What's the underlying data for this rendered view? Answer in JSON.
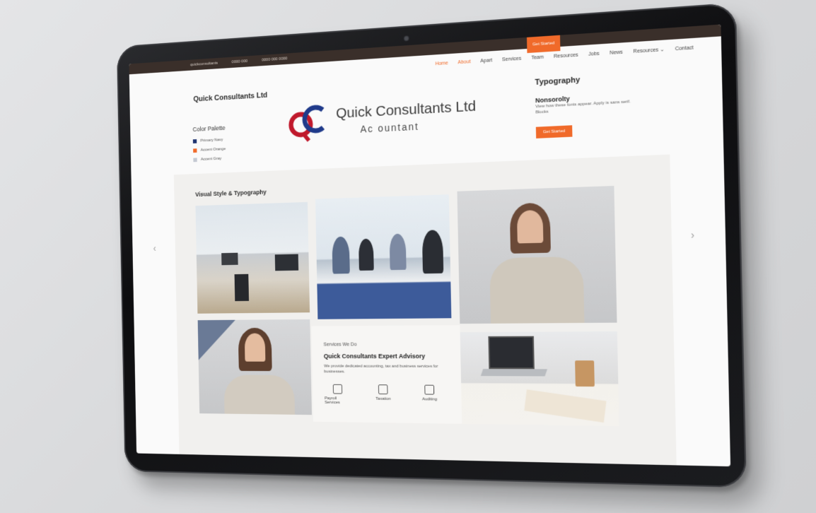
{
  "topbar": {
    "items": [
      "quickconsultants",
      "0000 000",
      "0000 000 0000"
    ],
    "cta": "Get Started"
  },
  "nav": {
    "items": [
      "Home",
      "About",
      "Apart",
      "Services",
      "Team",
      "Resources",
      "Jobs",
      "News",
      "Resources ⌄",
      "Contact"
    ]
  },
  "brand": "Quick Consultants Ltd",
  "palette": {
    "title": "Color Palette",
    "items": [
      {
        "label": "Primary Navy",
        "color": "#1f3470"
      },
      {
        "label": "Accent Orange",
        "color": "#f06a2a"
      },
      {
        "label": "Accent Gray",
        "color": "#c4c9d2"
      }
    ]
  },
  "logo": {
    "name": "Quick Consultants Ltd",
    "tagline": "Ac ountant",
    "colors": {
      "q": "#c0192c",
      "c": "#1f3a8a"
    }
  },
  "typography": {
    "title": "Typography",
    "subtitle": "Nonsorolty",
    "body": "View how these fonts appear. Apply is sans serif. Blocks",
    "button": "Get Started"
  },
  "gallery": {
    "title": "Visual Style & Typography",
    "prev": "‹",
    "next": "›"
  },
  "services": {
    "eyebrow": "Services We Do",
    "title": "Quick Consultants Expert Advisory",
    "desc": "We provide dedicated accounting, tax and business services for businesses.",
    "items": [
      {
        "label": "Payroll Services",
        "icon": "calculator-icon"
      },
      {
        "label": "Taxation",
        "icon": "document-icon"
      },
      {
        "label": "Auditing",
        "icon": "clipboard-icon"
      }
    ]
  },
  "accent": "#f06a2a"
}
